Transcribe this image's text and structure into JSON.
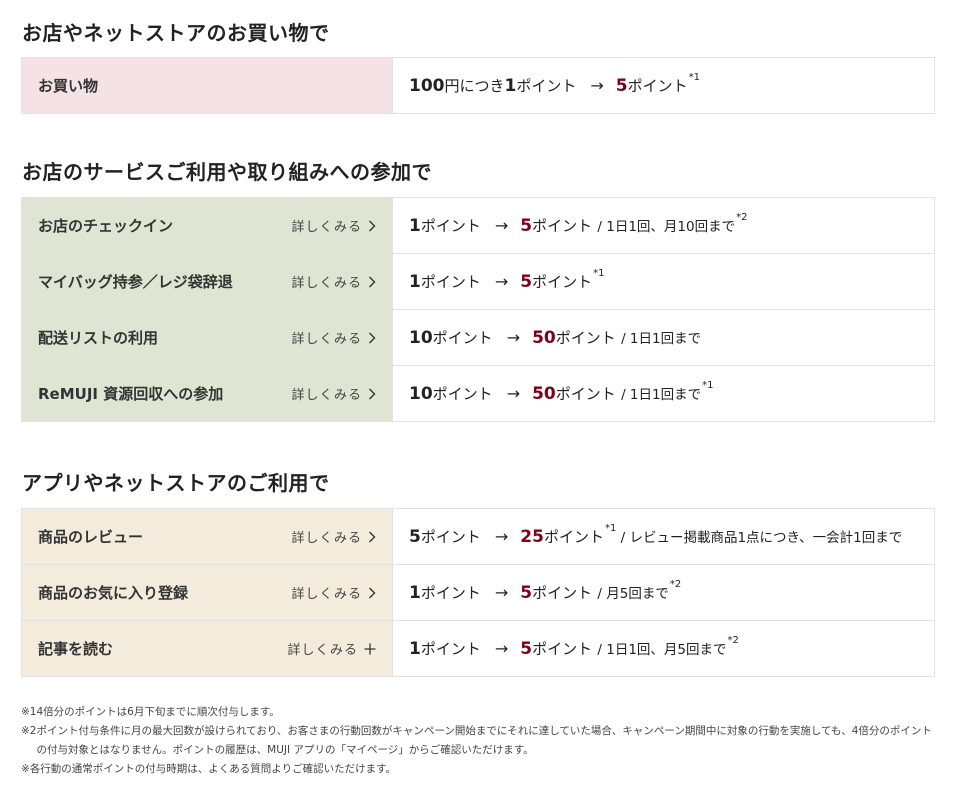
{
  "sections": [
    {
      "title": "お店やネットストアのお買い物で",
      "rows": [
        {
          "label": "お買い物",
          "detail": "",
          "base": "100",
          "base_unit": "円につき",
          "base2": "1",
          "base2_unit": "ポイント",
          "arrow": "→",
          "boost": "5",
          "boost_unit": "ポイント",
          "sup1": "*1",
          "extra": "",
          "sup2": ""
        }
      ]
    },
    {
      "title": "お店のサービスご利用や取り組みへの参加で",
      "rows": [
        {
          "label": "お店のチェックイン",
          "detail": "詳しくみる",
          "icon": "chevron-right-icon",
          "base": "1",
          "base_unit": "ポイント",
          "arrow": "→",
          "boost": "5",
          "boost_unit": "ポイント",
          "sup1": "",
          "extra": " / 1日1回、月10回まで",
          "sup2": "*2"
        },
        {
          "label": "マイバッグ持参／レジ袋辞退",
          "detail": "詳しくみる",
          "icon": "chevron-right-icon",
          "base": "1",
          "base_unit": "ポイント",
          "arrow": "→",
          "boost": "5",
          "boost_unit": "ポイント",
          "sup1": "*1",
          "extra": "",
          "sup2": ""
        },
        {
          "label": "配送リストの利用",
          "detail": "詳しくみる",
          "icon": "chevron-right-icon",
          "base": "10",
          "base_unit": "ポイント",
          "arrow": "→",
          "boost": "50",
          "boost_unit": "ポイント",
          "sup1": "",
          "extra": " / 1日1回まで",
          "sup2": ""
        },
        {
          "label": "ReMUJI 資源回収への参加",
          "detail": "詳しくみる",
          "icon": "chevron-right-icon",
          "base": "10",
          "base_unit": "ポイント",
          "arrow": "→",
          "boost": "50",
          "boost_unit": "ポイント",
          "sup1": "",
          "extra": " / 1日1回まで",
          "sup2": "*1"
        }
      ]
    },
    {
      "title": "アプリやネットストアのご利用で",
      "rows": [
        {
          "label": "商品のレビュー",
          "detail": "詳しくみる",
          "icon": "chevron-right-icon",
          "base": "5",
          "base_unit": "ポイント",
          "arrow": "→",
          "boost": "25",
          "boost_unit": "ポイント",
          "sup1": "*1",
          "extra": " / レビュー掲載商品1点につき、一会計1回まで",
          "sup2": ""
        },
        {
          "label": "商品のお気に入り登録",
          "detail": "詳しくみる",
          "icon": "chevron-right-icon",
          "base": "1",
          "base_unit": "ポイント",
          "arrow": "→",
          "boost": "5",
          "boost_unit": "ポイント",
          "sup1": "",
          "extra": " / 月5回まで",
          "sup2": "*2"
        },
        {
          "label": "記事を読む",
          "detail": "詳しくみる",
          "icon": "plus-icon",
          "base": "1",
          "base_unit": "ポイント",
          "arrow": "→",
          "boost": "5",
          "boost_unit": "ポイント",
          "sup1": "",
          "extra": " / 1日1回、月5回まで",
          "sup2": "*2"
        }
      ]
    }
  ],
  "notes": [
    {
      "mark": "※1 ",
      "text": "4倍分のポイントは6月下旬までに順次付与します。"
    },
    {
      "mark": "※2 ",
      "text": "ポイント付与条件に月の最大回数が設けられており、お客さまの行動回数がキャンペーン開始までにそれに達していた場合、キャンペーン期間中に対象の行動を実施しても、4倍分のポイントの付与対象とはなりません。ポイントの履歴は、MUJI アプリの「マイページ」からご確認いただけます。"
    },
    {
      "mark": "※ ",
      "text": "各行動の通常ポイントの付与時期は、よくある質問よりご確認いただけます。"
    }
  ],
  "colors": {
    "accent_red": "#7f0019",
    "pink_bg": "#f4e2e6",
    "green_bg": "#dfe5d2",
    "cream_bg": "#f3ecdd"
  }
}
